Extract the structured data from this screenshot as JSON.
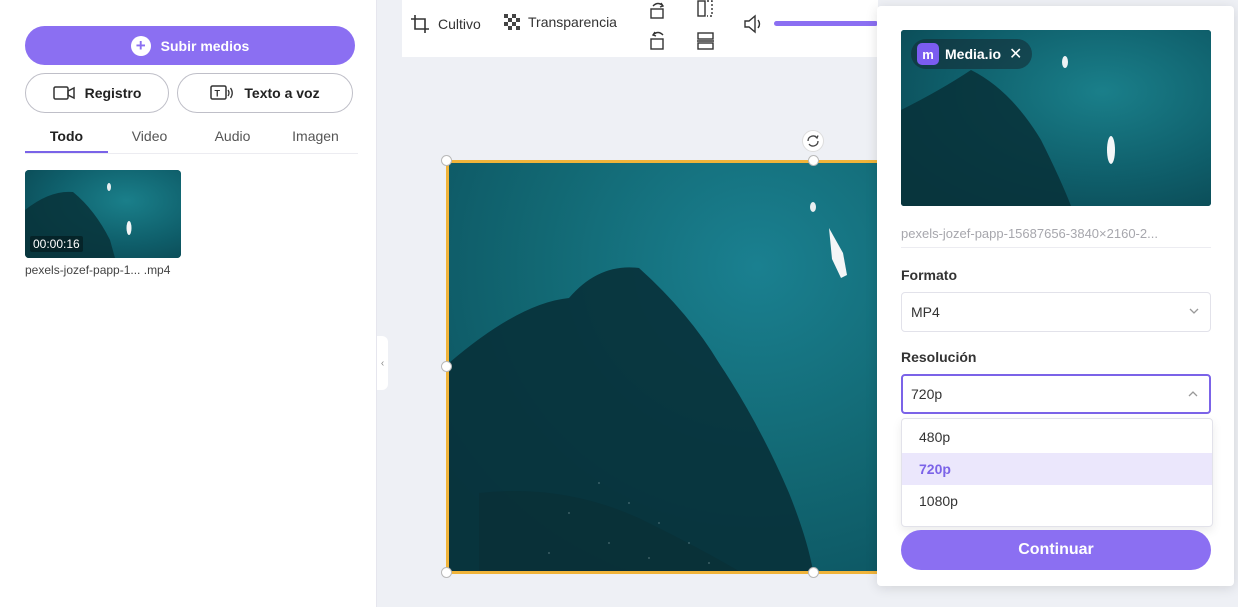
{
  "left_panel": {
    "upload_label": "Subir medios",
    "record_label": "Registro",
    "tts_label": "Texto a voz",
    "tabs": [
      "Todo",
      "Video",
      "Audio",
      "Imagen"
    ],
    "media": [
      {
        "duration": "00:00:16",
        "name": "pexels-jozef-papp-1... .mp4"
      }
    ]
  },
  "toolbar": {
    "crop_label": "Cultivo",
    "transparency_label": "Transparencia"
  },
  "export_panel": {
    "watermark": "Media.io",
    "filename": "pexels-jozef-papp-15687656-3840×2160-2...",
    "format_label": "Formato",
    "format_value": "MP4",
    "resolution_label": "Resolución",
    "resolution_value": "720p",
    "resolution_options": [
      "480p",
      "720p",
      "1080p"
    ],
    "continue_label": "Continuar"
  },
  "colors": {
    "accent": "#8b6ff2",
    "selection_border": "#f0b43a",
    "sea": "#0f5f6b"
  }
}
